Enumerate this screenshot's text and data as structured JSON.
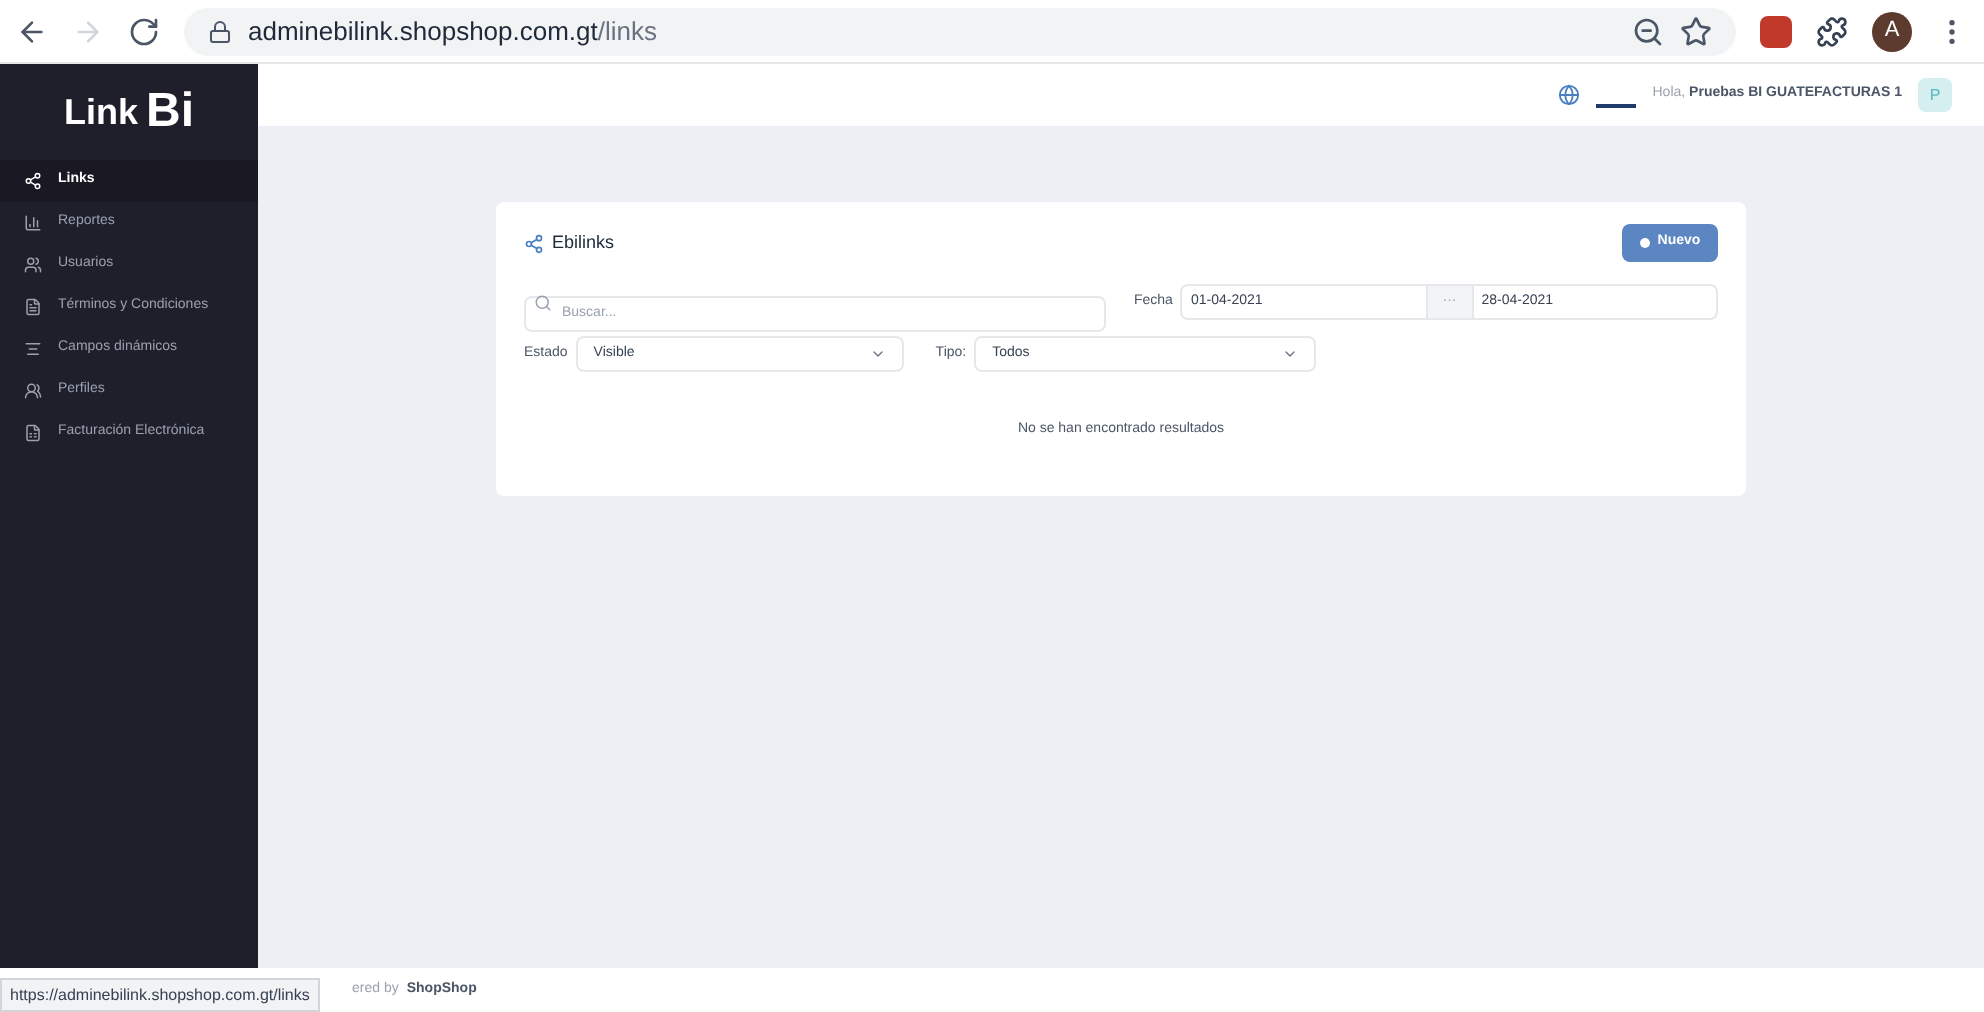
{
  "browser": {
    "url_host": "adminebilink.shopshop.com.gt",
    "url_path": "/links",
    "profile_initial": "A"
  },
  "sidebar": {
    "logo_text": "Link",
    "logo_mark": "Bi",
    "items": [
      {
        "label": "Links",
        "selected": true
      },
      {
        "label": "Reportes",
        "selected": false
      },
      {
        "label": "Usuarios",
        "selected": false
      },
      {
        "label": "Términos y Condiciones",
        "selected": false
      },
      {
        "label": "Campos dinámicos",
        "selected": false
      },
      {
        "label": "Perfiles",
        "selected": false
      },
      {
        "label": "Facturación Electrónica",
        "selected": false
      }
    ]
  },
  "header": {
    "greeting": "Hola,",
    "user_name": "Pruebas BI GUATEFACTURAS 1",
    "avatar_initial": "P"
  },
  "card": {
    "title": "Ebilinks",
    "new_button": "Nuevo",
    "search": {
      "placeholder": "Buscar..."
    },
    "date_label": "Fecha",
    "date_from": "01-04-2021",
    "date_separator": "···",
    "date_to": "28-04-2021",
    "estado_label": "Estado",
    "estado_value": "Visible",
    "tipo_label": "Tipo:",
    "tipo_value": "Todos",
    "empty_message": "No se han encontrado resultados"
  },
  "footer": {
    "prefix": "ered by",
    "brand": "ShopShop"
  },
  "status_bar": {
    "url": "https://adminebilink.shopshop.com.gt/links"
  }
}
